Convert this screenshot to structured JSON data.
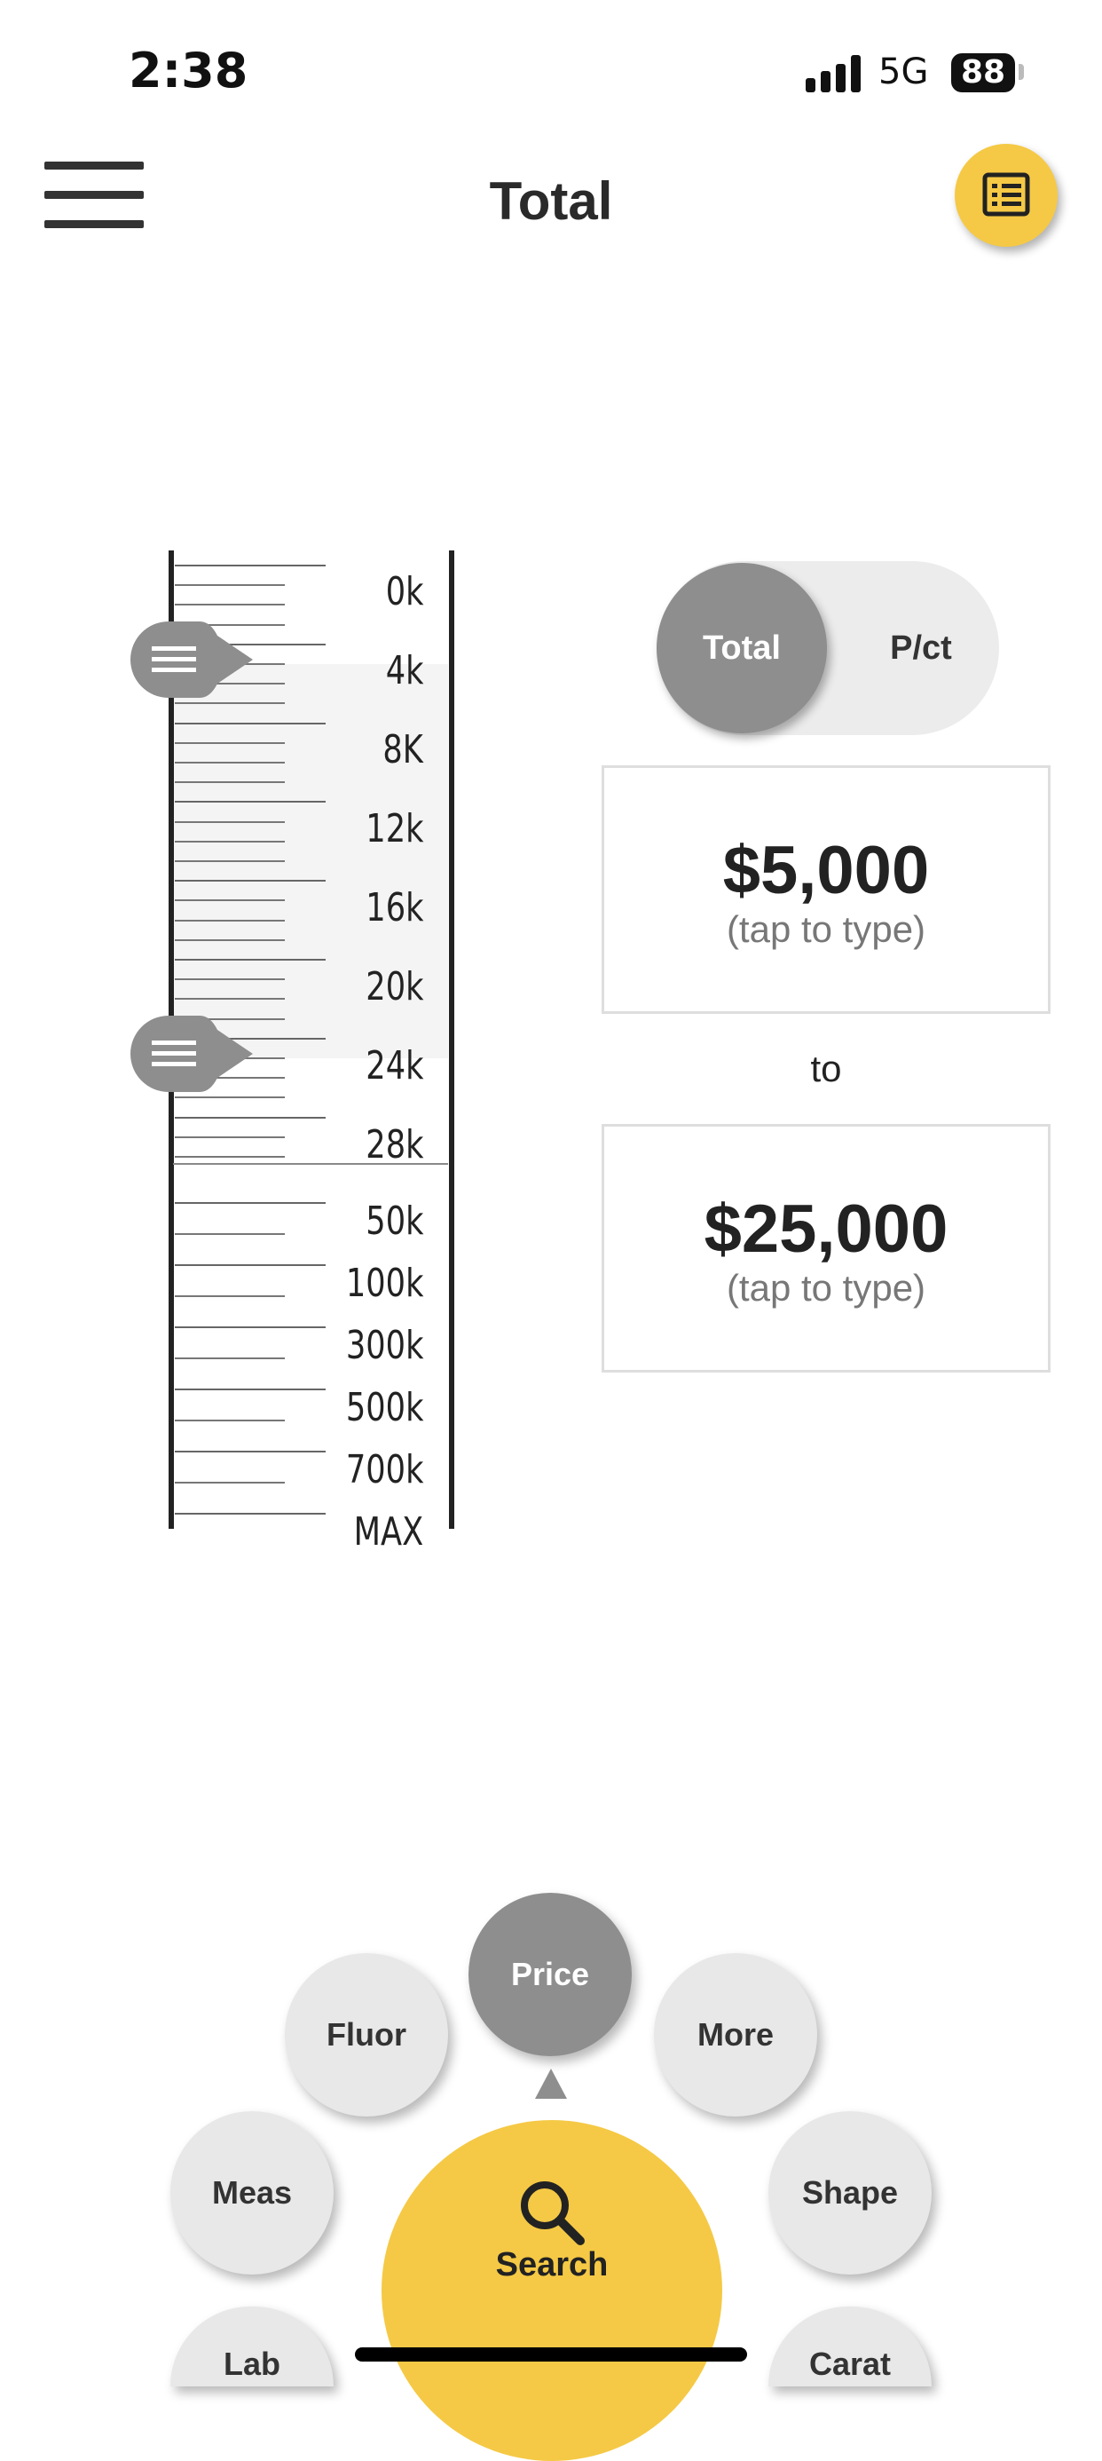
{
  "status_bar": {
    "time": "2:38",
    "network": "5G",
    "battery": "88"
  },
  "header": {
    "title": "Total",
    "menu_icon": "hamburger-icon",
    "list_icon": "list-icon"
  },
  "slider": {
    "upper_labels": [
      "0k",
      "4k",
      "8K",
      "12k",
      "16k",
      "20k",
      "24k",
      "28k"
    ],
    "lower_labels": [
      "50k",
      "100k",
      "300k",
      "500k",
      "700k",
      "MAX"
    ],
    "min_value": "4k",
    "max_value": "24k"
  },
  "toggle": {
    "active": "Total",
    "inactive": "P/ct"
  },
  "price_min": {
    "value": "$5,000",
    "hint": "(tap to type)"
  },
  "connector": "to",
  "price_max": {
    "value": "$25,000",
    "hint": "(tap to type)"
  },
  "nav": {
    "search": "Search",
    "fluor": "Fluor",
    "price": "Price",
    "more": "More",
    "meas": "Meas",
    "shape": "Shape",
    "lab": "Lab",
    "carat": "Carat"
  },
  "colors": {
    "accent": "#f5c945",
    "active": "#8e8e8e",
    "inactive": "#e8e8e8"
  }
}
